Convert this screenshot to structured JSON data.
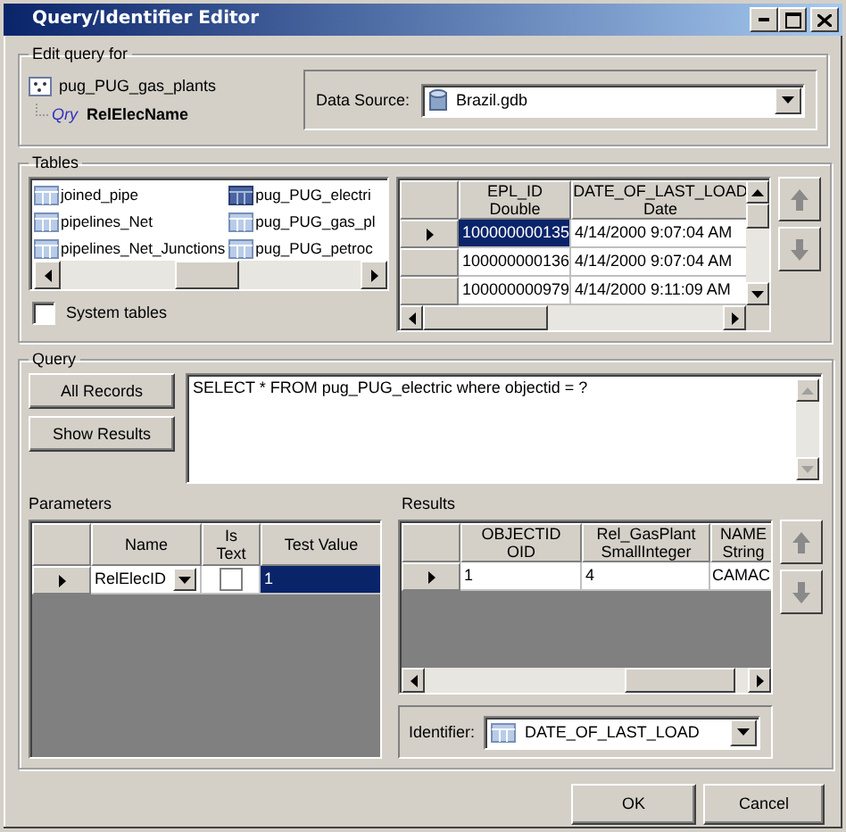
{
  "window": {
    "title": "Query/Identifier Editor"
  },
  "edit_query_for": {
    "label": "Edit query for",
    "tree": {
      "name": "pug_PUG_gas_plants",
      "children": [
        {
          "badge": "Qry",
          "name": "RelElecName"
        }
      ]
    },
    "data_source": {
      "label": "Data Source:",
      "value": "Brazil.gdb"
    }
  },
  "tables": {
    "label": "Tables",
    "list": [
      {
        "name": "joined_pipe",
        "selected": false
      },
      {
        "name": "pipelines_Net",
        "selected": false
      },
      {
        "name": "pipelines_Net_Junctions",
        "selected": false
      },
      {
        "name": "pug_PUG_electri",
        "selected": true
      },
      {
        "name": "pug_PUG_gas_pl",
        "selected": false
      },
      {
        "name": "pug_PUG_petroc",
        "selected": false
      }
    ],
    "system_tables": {
      "label": "System tables",
      "checked": false
    },
    "grid": {
      "columns": [
        {
          "name": "EPL_ID",
          "type": "Double"
        },
        {
          "name": "DATE_OF_LAST_LOAD",
          "type": "Date"
        }
      ],
      "rows": [
        {
          "current": true,
          "cells": [
            {
              "text": "100000000135",
              "selected": true
            },
            {
              "text": "4/14/2000 9:07:04 AM",
              "selected": false
            }
          ]
        },
        {
          "current": false,
          "cells": [
            {
              "text": "100000000136",
              "selected": false
            },
            {
              "text": "4/14/2000 9:07:04 AM",
              "selected": false
            }
          ]
        },
        {
          "current": false,
          "cells": [
            {
              "text": "100000000979",
              "selected": false
            },
            {
              "text": "4/14/2000 9:11:09 AM",
              "selected": false
            }
          ]
        }
      ]
    }
  },
  "query": {
    "label": "Query",
    "buttons": [
      "All Records",
      "Show Results"
    ],
    "sql": "SELECT * FROM pug_PUG_electric where objectid = ?"
  },
  "parameters": {
    "label": "Parameters",
    "columns": [
      "Name",
      "Is Text",
      "Test Value"
    ],
    "rows": [
      {
        "current": true,
        "name": "RelElecID",
        "is_text": false,
        "test_value": "1",
        "test_value_selected": true
      }
    ]
  },
  "results": {
    "label": "Results",
    "columns": [
      {
        "name": "OBJECTID",
        "type": "OID"
      },
      {
        "name": "Rel_GasPlant",
        "type": "SmallInteger"
      },
      {
        "name": "NAME",
        "type": "String"
      }
    ],
    "rows": [
      {
        "current": true,
        "cells": [
          "1",
          "4",
          "CAMAC"
        ]
      }
    ],
    "identifier": {
      "label": "Identifier:",
      "value": "DATE_OF_LAST_LOAD"
    }
  },
  "buttons": [
    "OK",
    "Cancel"
  ]
}
